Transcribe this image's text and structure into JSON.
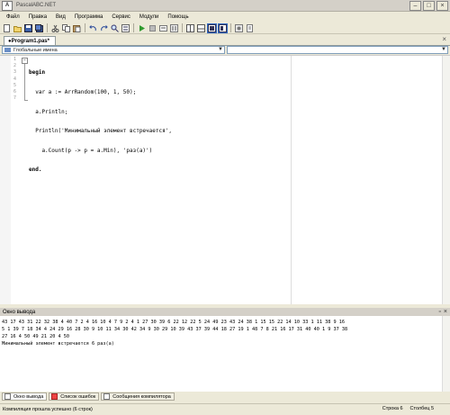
{
  "window": {
    "title": "PascalABC.NET"
  },
  "menu": [
    "Файл",
    "Правка",
    "Вид",
    "Программа",
    "Сервис",
    "Модули",
    "Помощь"
  ],
  "toolbar": {
    "buttons": [
      "new-file",
      "open",
      "save",
      "save-all",
      "cut",
      "copy",
      "paste",
      "undo",
      "redo",
      "find",
      "replace",
      "run",
      "stop",
      "step",
      "pause",
      "split-view",
      "panel-view",
      "output-view",
      "settings",
      "extra"
    ]
  },
  "tab": {
    "label": "●Program1.pas*",
    "close": "×"
  },
  "nav": {
    "left_label": "Глобальные имена"
  },
  "editor": {
    "line_numbers": [
      "1",
      "2",
      "3",
      "4",
      "5",
      "6",
      "7"
    ],
    "lines": [
      "begin",
      "  var a := ArrRandom(100, 1, 50);",
      "  a.Println;",
      "  Println('Минимальный элемент встречается',",
      "    a.Count(p -> p = a.Min), 'раз(а)')",
      "end.",
      ""
    ]
  },
  "output": {
    "title": "Окно вывода",
    "lines": [
      "43 17 43 31 22 32 38 4 40 7 2 4 16 10 4 7 9 2 4 1 27 30 39 6 22 12 22 5 24 49 23 43 24 38 1 15 15 22 14 10 33 1 11 38 9 16",
      "5 1 39 7 18 34 4 24 29 16 28 30 9 10 11 34 30 42 34 9 30 29 10 39 43 37 39 44 18 27 19 1 48 7 8 21 16 17 31 40 40 1 9 37 38",
      "27 16 4 50 49 21 20 4 50",
      "Минимальный элемент встречается 6 раз(а)"
    ]
  },
  "bottom_tabs": [
    "Окно вывода",
    "Список ошибок",
    "Сообщения компилятора"
  ],
  "status": {
    "message": "Компиляция прошла успешно (6 строк)",
    "row_label": "Строка",
    "row_value": "6",
    "col_label": "Столбец",
    "col_value": "5"
  }
}
